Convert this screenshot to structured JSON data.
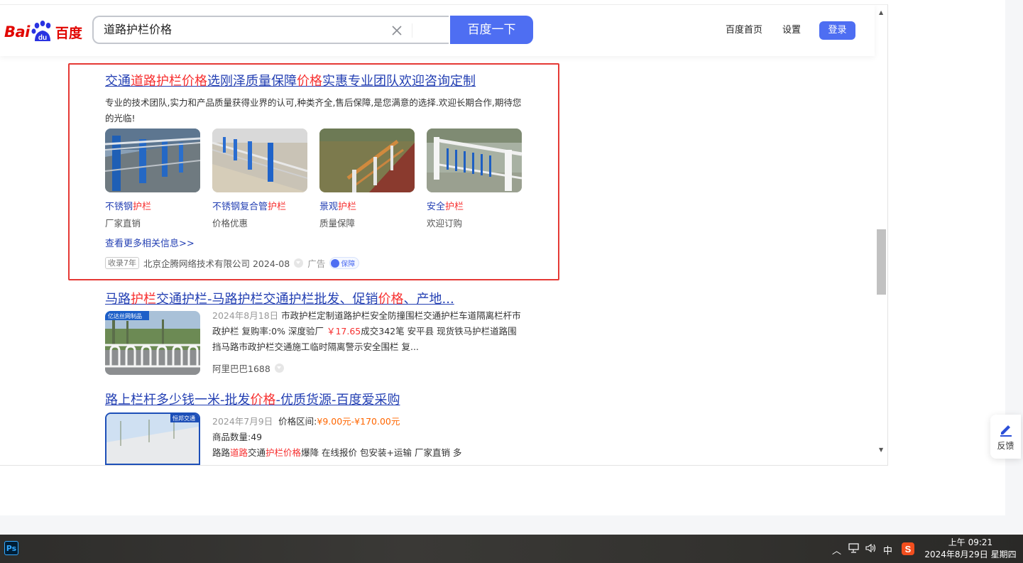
{
  "header": {
    "logo_text_en": "Bai",
    "logo_text_du": "du",
    "logo_text_cn": "百度",
    "search_value": "道路护栏价格",
    "search_button": "百度一下",
    "links": [
      "百度首页",
      "设置"
    ],
    "login": "登录"
  },
  "ad": {
    "title_parts": [
      "交通",
      "道路护栏价格",
      "选刚泽质量保障",
      "价格",
      "实惠专业团队欢迎咨询定制"
    ],
    "desc": "专业的技术团队,实力和产品质量获得业界的认可,种类齐全,售后保障,是您满意的选择.欢迎长期合作,期待您的光临!",
    "products": [
      {
        "name_plain": "不锈钢",
        "name_hl": "护栏",
        "sub": "厂家直销"
      },
      {
        "name_plain": "不锈钢复合管",
        "name_hl": "护栏",
        "sub": "价格优惠"
      },
      {
        "name_plain": "景观",
        "name_hl": "护栏",
        "sub": "质量保障"
      },
      {
        "name_plain": "安全",
        "name_hl": "护栏",
        "sub": "欢迎订购"
      }
    ],
    "more": "查看更多相关信息>>",
    "years_tag": "收录7年",
    "company": "北京企腾网络技术有限公司 2024-08",
    "ad_label": "广告",
    "bao_label": "保障"
  },
  "result2": {
    "title_parts": [
      "马路",
      "护栏",
      "交通护栏-马路护栏交通护栏批发、促销",
      "价格",
      "、产地..."
    ],
    "thumb_tag": "亿达丝网制品",
    "date": "2024年8月18日",
    "desc_a": "市政护栏定制道路护栏安全防撞围栏交通护栏车道隔离栏杆市政护栏 复购率:0% 深度验厂 ",
    "price": "￥17.65",
    "desc_b": "成交342笔 安平县 现货铁马护栏道路围挡马路市政护栏交通施工临时隔离警示安全围栏 复...",
    "source": "阿里巴巴1688"
  },
  "result3": {
    "title_parts": [
      "路上栏杆多少钱一米-批发",
      "价格",
      "-优质货源-百度爱采购"
    ],
    "thumb_tag": "恒邦交通",
    "date": "2024年7月9日",
    "price_label": "价格区间:",
    "price_range": "¥9.00元-¥170.00元",
    "qty": "商品数量:49",
    "line3_parts": [
      "路路",
      "道路",
      "交通",
      "护栏价格",
      "爆降 在线报价 包安装+运输 厂家直销 多"
    ]
  },
  "feedback": "反馈",
  "taskbar": {
    "ps": "Ps",
    "ime": "中",
    "time": "上午 09:21",
    "date": "2024年8月29日 星期四"
  }
}
